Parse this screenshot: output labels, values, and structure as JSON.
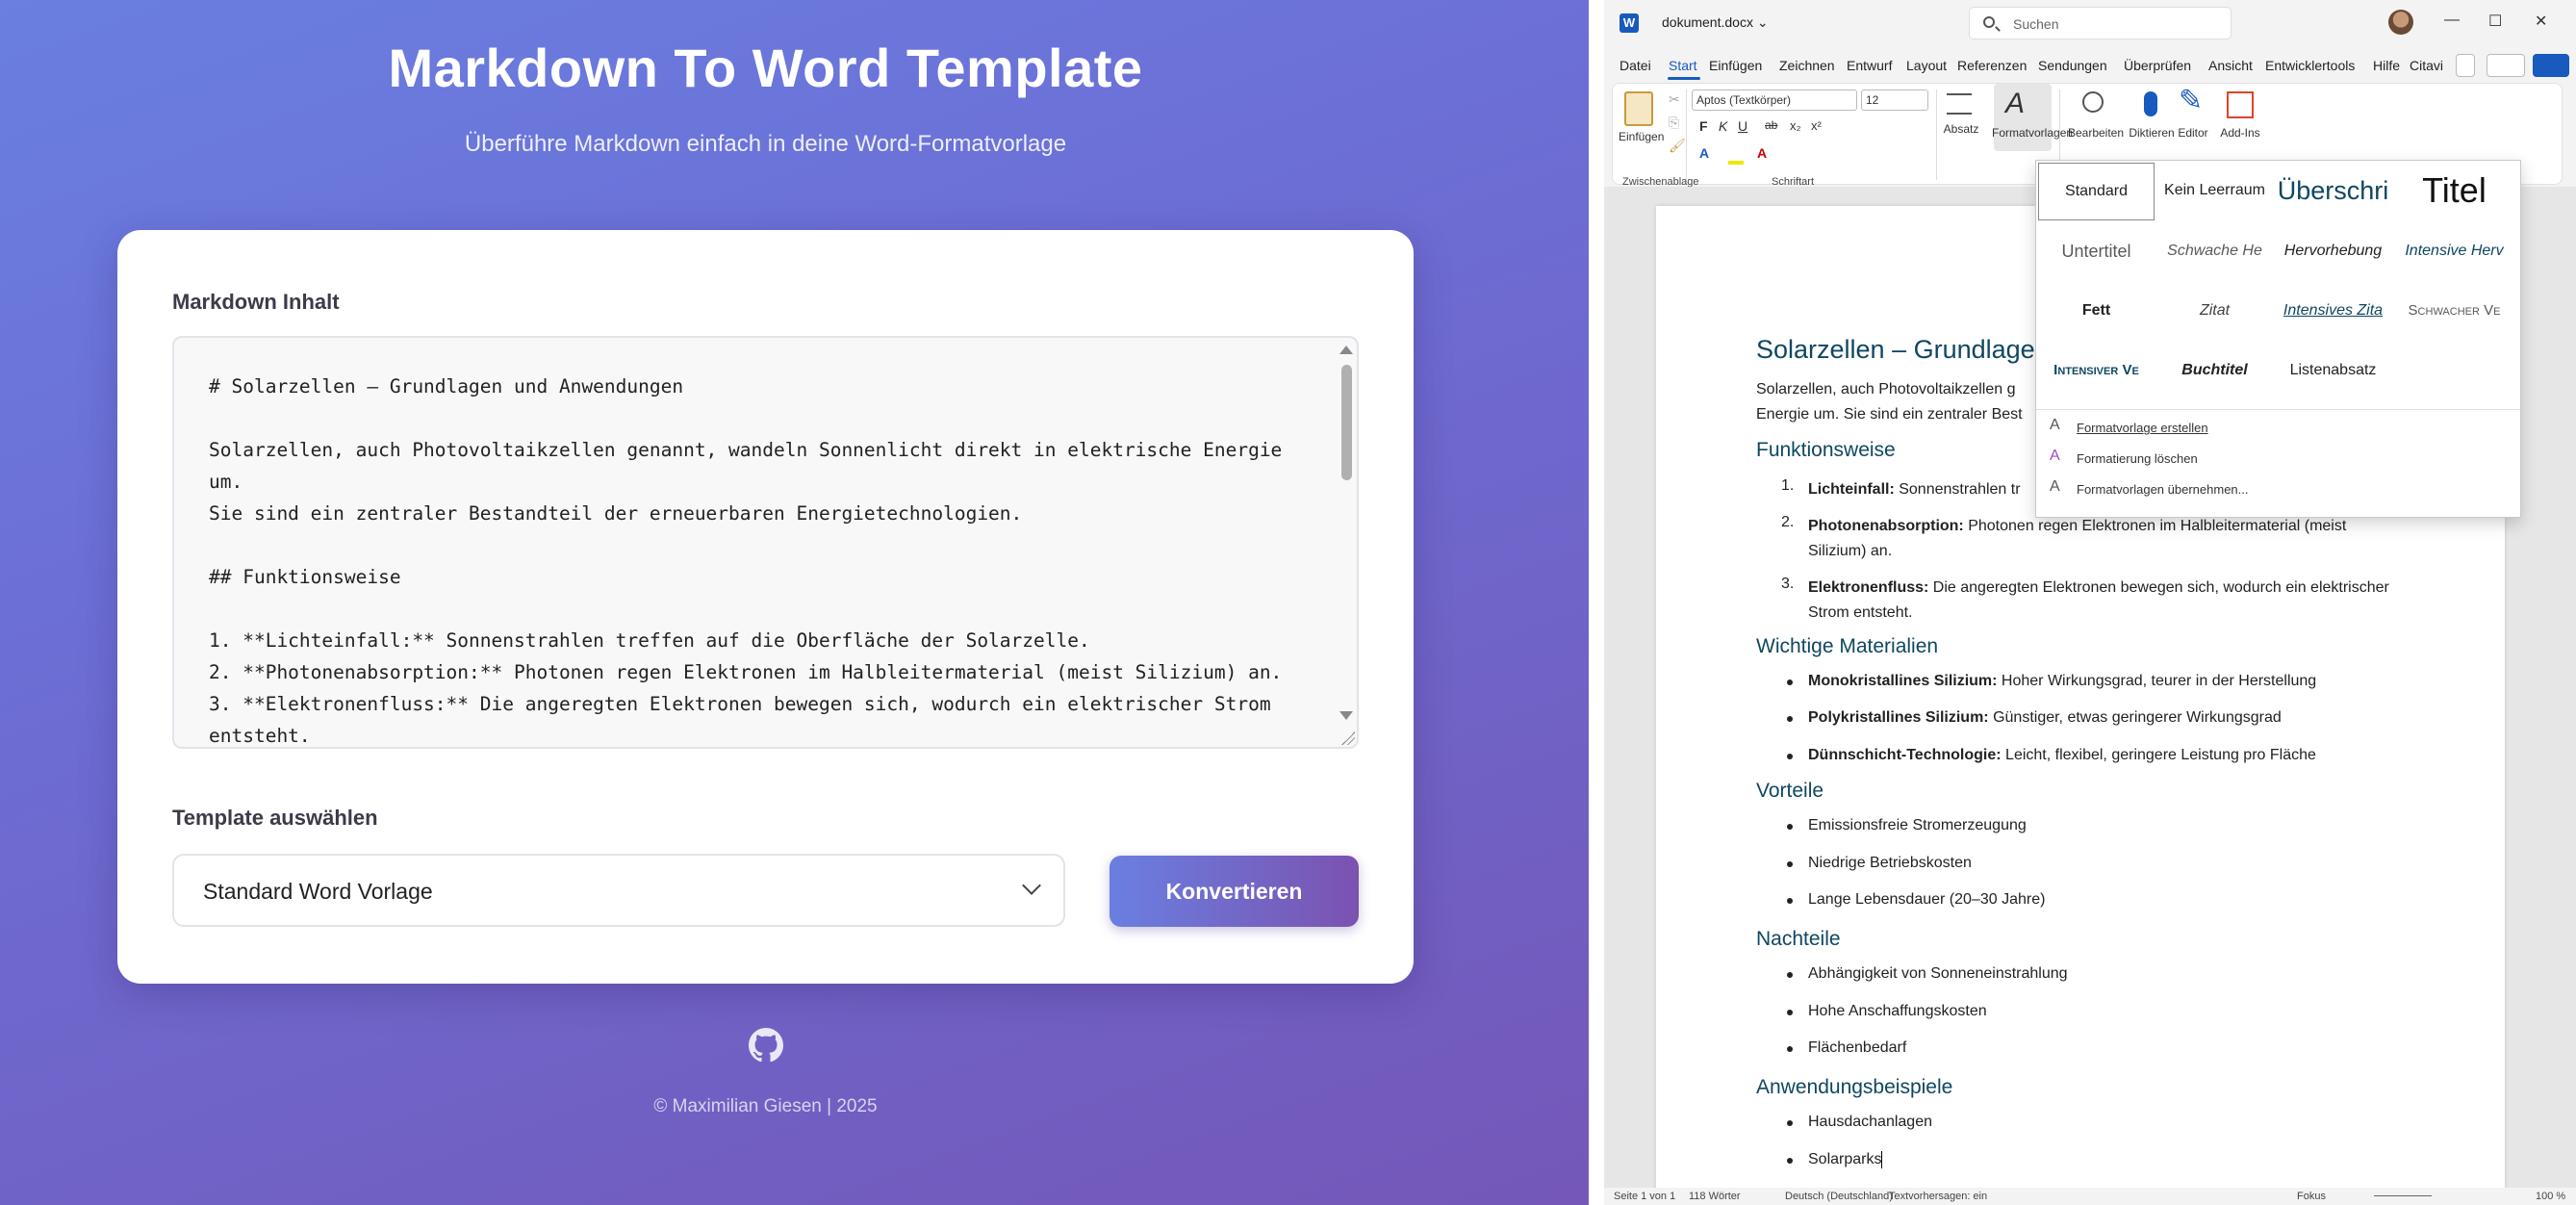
{
  "app": {
    "title": "Markdown To Word Template",
    "subtitle": "Überführe Markdown einfach in deine Word-Formatvorlage",
    "markdown_label": "Markdown Inhalt",
    "markdown_content": "# Solarzellen – Grundlagen und Anwendungen\n\nSolarzellen, auch Photovoltaikzellen genannt, wandeln Sonnenlicht direkt in elektrische Energie um.\nSie sind ein zentraler Bestandteil der erneuerbaren Energietechnologien.\n\n## Funktionsweise\n\n1. **Lichteinfall:** Sonnenstrahlen treffen auf die Oberfläche der Solarzelle.\n2. **Photonenabsorption:** Photonen regen Elektronen im Halbleitermaterial (meist Silizium) an.\n3. **Elektronenfluss:** Die angeregten Elektronen bewegen sich, wodurch ein elektrischer Strom\nentsteht.",
    "template_label": "Template auswählen",
    "template_selected": "Standard Word Vorlage",
    "convert_button": "Konvertieren",
    "footer": "© Maximilian Giesen | 2025",
    "github_icon": "github-icon"
  },
  "word": {
    "doc_name": "dokument.docx",
    "search_placeholder": "Suchen",
    "window_buttons": [
      "—",
      "☐",
      "✕"
    ],
    "tabs": [
      "Datei",
      "Start",
      "Einfügen",
      "Zeichnen",
      "Entwurf",
      "Layout",
      "Referenzen",
      "Sendungen",
      "Überprüfen",
      "Ansicht",
      "Entwicklertools",
      "Hilfe",
      "Citavi"
    ],
    "ribbon": {
      "paste": "Einfügen",
      "clipboard_group": "Zwischenablage",
      "font_name": "Aptos (Textkörper)",
      "font_size": "12",
      "font_group": "Schriftart",
      "paragraph": "Absatz",
      "styles": "Formatvorlagen",
      "edit": "Bearbeiten",
      "dictate": "Diktieren",
      "editor": "Editor",
      "addins": "Add-Ins",
      "format_buttons": [
        "F",
        "K",
        "U",
        "ab",
        "x₂",
        "x²"
      ]
    },
    "gallery": {
      "styles": [
        "Standard",
        "Kein Leerraum",
        "Überschri",
        "Titel",
        "Untertitel",
        "Schwache He",
        "Hervorhebung",
        "Intensive Herv",
        "Fett",
        "Zitat",
        "Intensives Zita",
        "Schwacher Ve",
        "Intensiver Ve",
        "Buchtitel",
        "Listenabsatz"
      ],
      "commands": [
        "Formatvorlage erstellen",
        "Formatierung löschen",
        "Formatvorlagen übernehmen..."
      ]
    },
    "document": {
      "h1": "Solarzellen – Grundlagen",
      "intro_1": "Solarzellen, auch Photovoltaikzellen g",
      "intro_2": "Energie um. Sie sind ein zentraler Best",
      "sections": {
        "funktion": {
          "title": "Funktionsweise",
          "items": [
            {
              "bold": "Lichteinfall:",
              "text": " Sonnenstrahlen tr"
            },
            {
              "bold": "Photonenabsorption:",
              "text": " Photonen regen Elektronen im Halbleitermaterial (meist Silizium) an."
            },
            {
              "bold": "Elektronenfluss:",
              "text": " Die angeregten Elektronen bewegen sich, wodurch ein elektrischer Strom entsteht."
            }
          ]
        },
        "materialien": {
          "title": "Wichtige Materialien",
          "items": [
            {
              "bold": "Monokristallines Silizium:",
              "text": " Hoher Wirkungsgrad, teurer in der Herstellung"
            },
            {
              "bold": "Polykristallines Silizium:",
              "text": " Günstiger, etwas geringerer Wirkungsgrad"
            },
            {
              "bold": "Dünnschicht-Technologie:",
              "text": " Leicht, flexibel, geringere Leistung pro Fläche"
            }
          ]
        },
        "vorteile": {
          "title": "Vorteile",
          "items": [
            "Emissionsfreie Stromerzeugung",
            "Niedrige Betriebskosten",
            "Lange Lebensdauer (20–30 Jahre)"
          ]
        },
        "nachteile": {
          "title": "Nachteile",
          "items": [
            "Abhängigkeit von Sonneneinstrahlung",
            "Hohe Anschaffungskosten",
            "Flächenbedarf"
          ]
        },
        "anwendung": {
          "title": "Anwendungsbeispiele",
          "items": [
            "Hausdachanlagen",
            "Solarparks"
          ]
        }
      }
    },
    "status": {
      "page": "Seite 1 von 1",
      "words": "118 Wörter",
      "language": "Deutsch (Deutschland)",
      "predictions": "Textvorhersagen: ein",
      "focus": "Fokus",
      "zoom": "100 %"
    }
  }
}
